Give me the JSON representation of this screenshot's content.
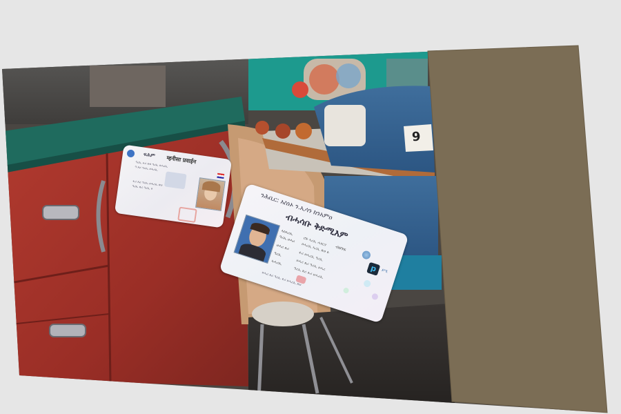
{
  "scene": {
    "description_colors": {
      "background": "#e6e6e6",
      "wall_panel": "#7b6d55",
      "cabinet_red": "#a8322a",
      "counter_green": "#1f6b5e"
    },
    "table_number": "9"
  },
  "card_left": {
    "header_left": "ፍሕም",
    "header_right": "म्हनीसा प्रवाईन",
    "lines": [
      "ዓሪኢ ፉሪ ጽሀ ዓሪኢ ሀሓሪኢ",
      "ዓ ጸሪ ዓሪኢ ሀሓሪኢ",
      "ፉሪ ጸሪ ዓሪኢ ሀሓሪኢ ጽሀ",
      "ዓሪኢ ጸሪ ዓሪኢ ሀ"
    ],
    "field_labels": [
      "",
      ""
    ],
    "flag_icon": "flag-icon",
    "logo_icon": "circle-logo-icon",
    "portrait": "child-portrait"
  },
  "card_right": {
    "header": "ንሕቢር: አስነኦ ን.ኢሳን ከንአምዐ",
    "name": "ብሓሳቡ ቅድሚእም",
    "fields": [
      {
        "label": "ኣስኣሪኢ",
        "value": "ሮፉ ኣሪኢ ሓፃርሃ"
      },
      {
        "label": "ዓሪኢ ሀሓሪ",
        "value": "ሀሓሪኢ ኣሪኢ ጽሀ ፉ"
      },
      {
        "label": "ሀሓሪ ጸሪ",
        "value": "ፉሪ ሀሓሪኢ ዓሪኢ"
      },
      {
        "label": "ዓሪኢ",
        "value": "ሀሓሪ ጸሪ ዓሪኢ ሀሓሪ"
      },
      {
        "label": "ኣሓሪኢ",
        "value": "ዓሪኢ ጸሪ ፉሪ ሀሓሪኢ"
      }
    ],
    "right_label": "ብዩገፍ",
    "logo_text": "ይሢ",
    "footer": "ሀሓሪ ጸሪ ዓሪኢ ፉሪ ሀሓሪኢ ጽሀ",
    "portrait": "man-portrait",
    "logo_icon": "p-logo-icon"
  }
}
